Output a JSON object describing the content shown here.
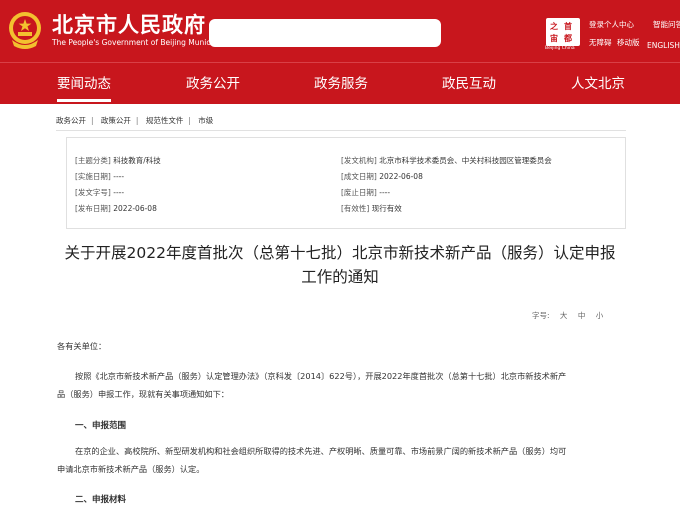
{
  "header": {
    "site_title": "北京市人民政府",
    "site_subtitle": "The People's Government of Beijing Municipality",
    "search_placeholder": "",
    "seal_chars": [
      "之",
      "首",
      "宙",
      "都"
    ],
    "seal_caption": "Beijing China",
    "links": {
      "login": "登录个人中心",
      "barrier_free": "无障碍",
      "mobile": "移动版",
      "smart": "智能问答",
      "english": "ENGLISH"
    }
  },
  "nav": {
    "items": [
      "要闻动态",
      "政务公开",
      "政务服务",
      "政民互动",
      "人文北京"
    ],
    "active_index": 0
  },
  "breadcrumb": [
    "政务公开",
    "政策公开",
    "规范性文件",
    "市级"
  ],
  "meta": {
    "subject_label": "[主题分类]",
    "subject": "科技教育/科技",
    "issuer_label": "[发文机构]",
    "issuer": "北京市科学技术委员会、中关村科技园区管理委员会",
    "effective_label": "[实施日期]",
    "effective": "----",
    "written_label": "[成文日期]",
    "written": "2022-06-08",
    "docno_label": "[发文字号]",
    "docno": "----",
    "abolish_label": "[废止日期]",
    "abolish": "----",
    "publish_label": "[发布日期]",
    "publish": "2022-06-08",
    "validity_label": "[有效性]",
    "validity": "现行有效"
  },
  "article": {
    "title_line1": "关于开展2022年度首批次（总第十七批）北京市新技术新产品（服务）认定申报",
    "title_line2": "工作的通知",
    "font_size_label": "字号:",
    "font_sizes": [
      "大",
      "中",
      "小"
    ],
    "salutation": "各有关单位：",
    "para1_line1": "按照《北京市新技术新产品（服务）认定管理办法》（京科发〔2014〕622号），开展2022年度首批次（总第十七批）北京市新技术新产",
    "para1_line2": "品（服务）申报工作，现就有关事项通知如下：",
    "section1": "一、申报范围",
    "para2_line1": "在京的企业、高校院所、新型研发机构和社会组织所取得的技术先进、产权明晰、质量可靠、市场前景广阔的新技术新产品（服务）均可",
    "para2_line2": "申请北京市新技术新产品（服务）认定。",
    "section2": "二、申报材料"
  }
}
